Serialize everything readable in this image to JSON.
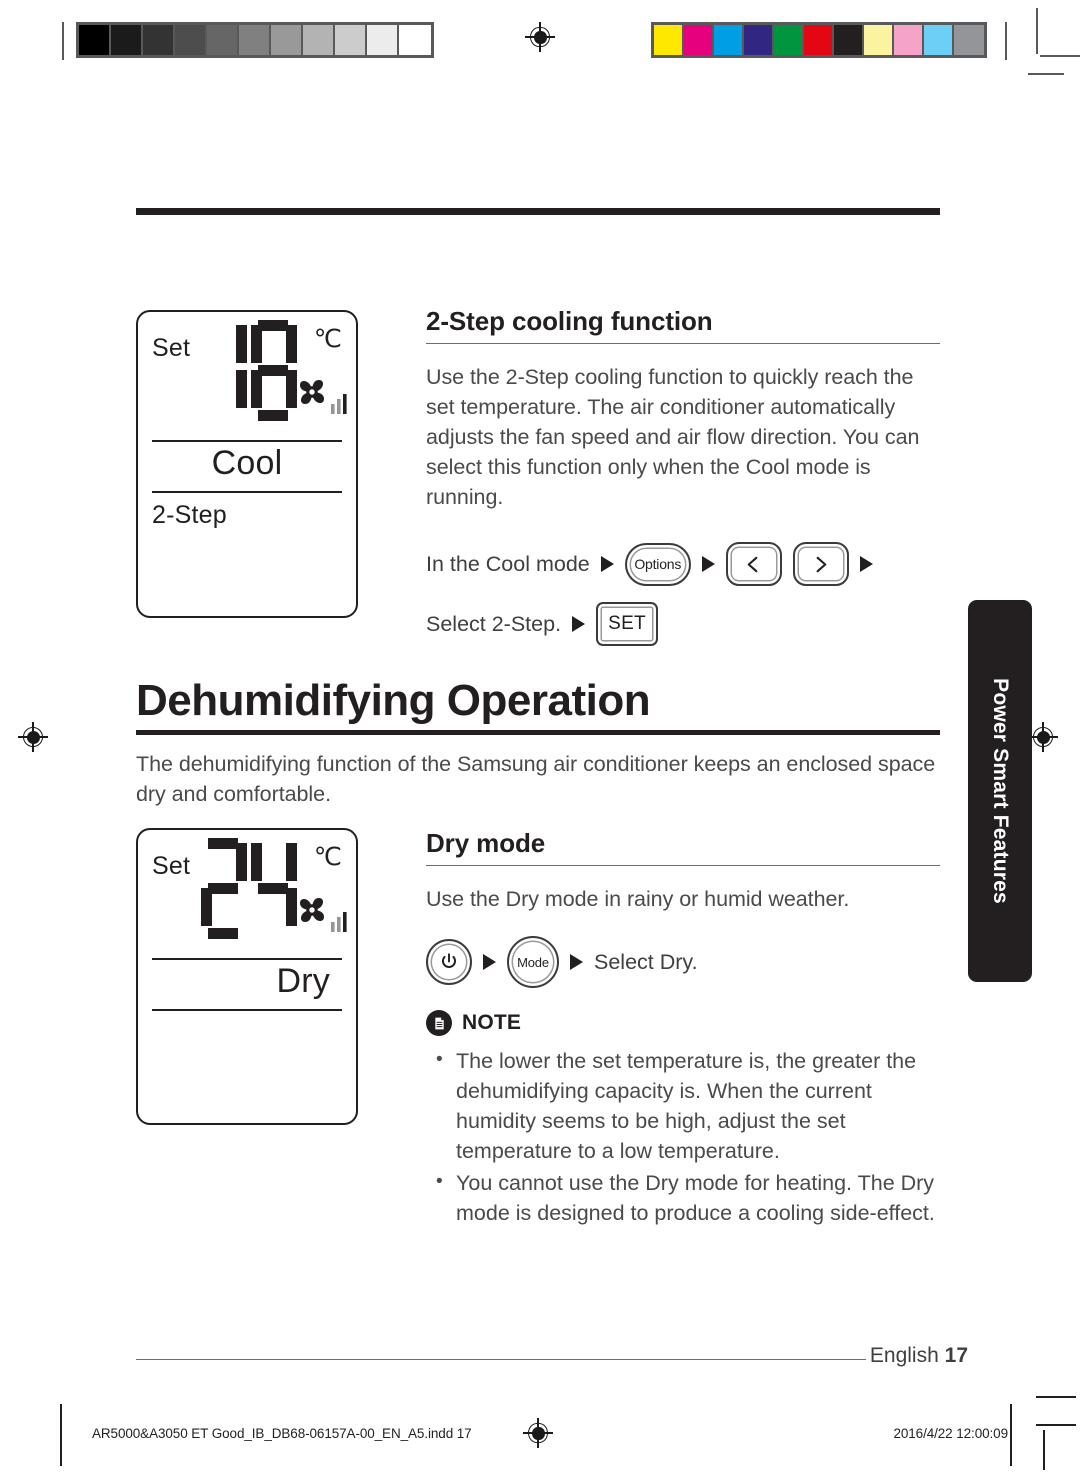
{
  "document": {
    "page_number": "17",
    "language_label": "English",
    "side_tab_label": "Power Smart Features"
  },
  "calibration": {
    "grayscale_steps": [
      "#000000",
      "#1b1b1b",
      "#333333",
      "#4d4d4d",
      "#666666",
      "#808080",
      "#999999",
      "#b3b3b3",
      "#cccccc",
      "#ececec",
      "#ffffff"
    ],
    "color_swatches": [
      "#ffe800",
      "#e6007e",
      "#009fe3",
      "#312783",
      "#009640",
      "#e30613",
      "#231f20",
      "#fbf3a0",
      "#f5a3c7",
      "#6ecff6",
      "#939598"
    ]
  },
  "lcd_cool": {
    "set_label": "Set",
    "temperature": "18",
    "unit": "℃",
    "mode": "Cool",
    "sub_label": "2-Step",
    "fan_icon": "fan-icon"
  },
  "lcd_dry": {
    "set_label": "Set",
    "temperature": "24",
    "unit": "℃",
    "mode": "Dry",
    "sub_label": "",
    "fan_icon": "fan-icon"
  },
  "section_two_step": {
    "heading": "2-Step cooling function",
    "body": "Use the 2-Step cooling function to quickly reach the set temperature. The air conditioner automatically adjusts the fan speed and air flow direction. You can select this function only when the Cool mode is running.",
    "step1_label": "In the Cool mode",
    "step1_button": "Options",
    "step1_arrow_left": "chevron-left-icon",
    "step1_arrow_right": "chevron-right-icon",
    "step2_label": "Select 2-Step.",
    "step2_button": "SET"
  },
  "section_dehumidifying": {
    "heading": "Dehumidifying Operation",
    "body": "The dehumidifying function of the Samsung air conditioner keeps an enclosed space dry and comfortable."
  },
  "section_dry_mode": {
    "heading": "Dry mode",
    "body": "Use the Dry mode in rainy or humid weather.",
    "power_button": "power-icon",
    "mode_button": "Mode",
    "action_label": "Select Dry."
  },
  "note": {
    "icon": "note-document-icon",
    "label": "NOTE",
    "items": [
      "The lower the set temperature is, the greater the dehumidifying capacity is. When the current humidity seems to be high, adjust the set temperature to a low temperature.",
      "You cannot use the Dry mode for heating. The Dry mode is designed to produce a cooling side-effect."
    ]
  },
  "imprint": {
    "filename": "AR5000&A3050 ET Good_IB_DB68-06157A-00_EN_A5.indd   17",
    "timestamp": "2016/4/22   12:00:09"
  }
}
